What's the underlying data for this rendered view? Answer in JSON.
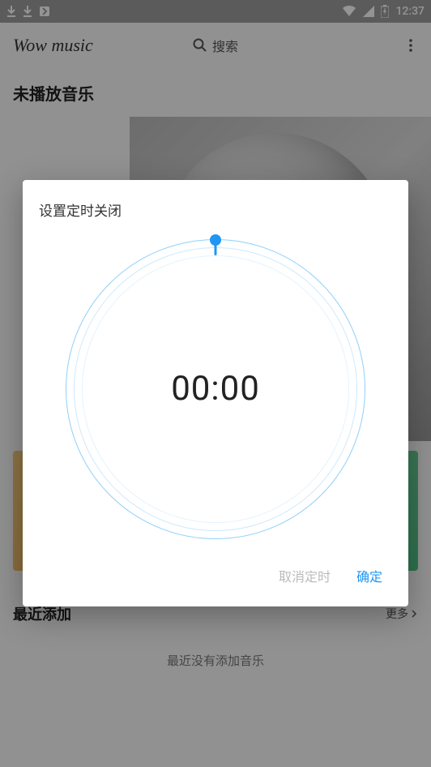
{
  "status_bar": {
    "time": "12:37"
  },
  "header": {
    "app_title": "Wow music",
    "search_label": "搜索"
  },
  "main": {
    "now_playing_title": "未播放音乐",
    "recent_title": "最近添加",
    "more_label": "更多",
    "empty_recent": "最近没有添加音乐"
  },
  "dialog": {
    "title": "设置定时关闭",
    "time_value": "00:00",
    "cancel_label": "取消定时",
    "ok_label": "确定"
  }
}
